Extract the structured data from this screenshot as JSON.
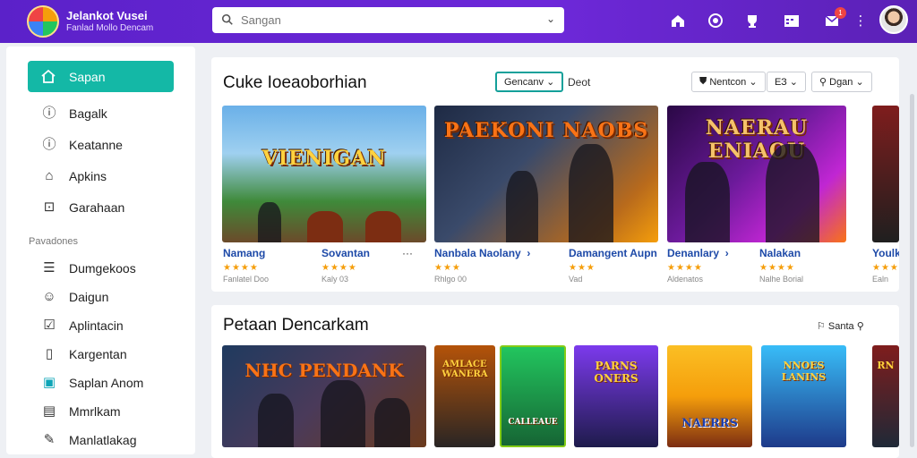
{
  "header": {
    "brand_title": "Jelankot Vusei",
    "brand_subtitle": "Fanlad Mollo Dencam",
    "search_placeholder": "Sangan",
    "notification_count": "1",
    "icons": [
      "home-icon",
      "target-icon",
      "trophy-icon",
      "calendar-icon",
      "mail-icon",
      "more-icon"
    ]
  },
  "sidebar": {
    "active": {
      "label": "Sapan",
      "icon": "home-icon"
    },
    "items": [
      {
        "label": "Bagalk",
        "icon": "info-icon"
      },
      {
        "label": "Keatanne",
        "icon": "info-icon"
      },
      {
        "label": "Apkins",
        "icon": "shapes-icon"
      },
      {
        "label": "Garahaan",
        "icon": "gift-icon"
      }
    ],
    "section_label": "Pavadones",
    "items2": [
      {
        "label": "Dumgekoos",
        "icon": "list-icon"
      },
      {
        "label": "Daigun",
        "icon": "user-icon"
      },
      {
        "label": "Aplintacin",
        "icon": "check-icon"
      },
      {
        "label": "Kargentan",
        "icon": "bookmark-icon"
      },
      {
        "label": "Saplan Anom",
        "icon": "calendar-icon"
      },
      {
        "label": "Mmrlkam",
        "icon": "doc-icon"
      },
      {
        "label": "Manlatlakag",
        "icon": "pen-icon"
      }
    ]
  },
  "section1": {
    "title": "Cuke Ioeaoborhian",
    "filter_chip": "Gencanv",
    "sort_label": "Deot",
    "chips": [
      "Nentcon",
      "ЕЗ",
      "Dgan"
    ],
    "cards": [
      {
        "art_title": "VIENIGAN",
        "name": "Namang",
        "stars": "★★★★",
        "sub": "Fanlatel Doo",
        "colors": [
          "#4f8fd0",
          "#2f6b2a"
        ],
        "accent": "#f59e0b"
      },
      {
        "art_title": "",
        "name": "Sovantan",
        "stars": "★★★★",
        "sub": "Kaly 03",
        "colors": [],
        "accent": ""
      },
      {
        "art_title": "PAEKONI NAOBS",
        "name": "Nanbala Naolany",
        "stars": "★★★",
        "sub": "Rhlgo 00",
        "colors": [
          "#1e2a44",
          "#b86a1c"
        ],
        "accent": "#f97316"
      },
      {
        "art_title": "",
        "name": "Damangent Aupn",
        "stars": "★★★",
        "sub": "Vad",
        "colors": [],
        "accent": ""
      },
      {
        "art_title": "NAERAU ENIAOU",
        "name": "Denanlary",
        "stars": "★★★★",
        "sub": "Aldenatos",
        "colors": [
          "#3b0f5e",
          "#c026d3"
        ],
        "accent": "#f0abfc"
      },
      {
        "art_title": "",
        "name": "Nalakan",
        "stars": "★★★★",
        "sub": "Nalhe Borial",
        "colors": [],
        "accent": ""
      },
      {
        "art_title": "",
        "name": "Youlk",
        "stars": "★★★",
        "sub": "Ealn",
        "colors": [
          "#7f1d1d",
          "#1f1f1f"
        ],
        "accent": "#ef4444"
      }
    ]
  },
  "section2": {
    "title": "Petaan Dencarkam",
    "action_label": "Santa",
    "cards": [
      {
        "art_title": "NHC PENDANK",
        "colors": [
          "#1f3a5f",
          "#6b3a1c"
        ]
      },
      {
        "art_title": "AMLACE WANERA",
        "colors": [
          "#7c2d12",
          "#292524"
        ]
      },
      {
        "art_title": "CALLEAUE",
        "colors": [
          "#166534",
          "#22c55e"
        ]
      },
      {
        "art_title": "PARNS ONERS",
        "colors": [
          "#1e1b4b",
          "#7c3aed"
        ]
      },
      {
        "art_title": "NAERRS",
        "colors": [
          "#f59e0b",
          "#7c2d12"
        ]
      },
      {
        "art_title": "NNOES LANINS",
        "colors": [
          "#0ea5e9",
          "#1e3a8a"
        ]
      },
      {
        "art_title": "RN",
        "colors": [
          "#7f1d1d",
          "#1f2937"
        ]
      }
    ]
  }
}
